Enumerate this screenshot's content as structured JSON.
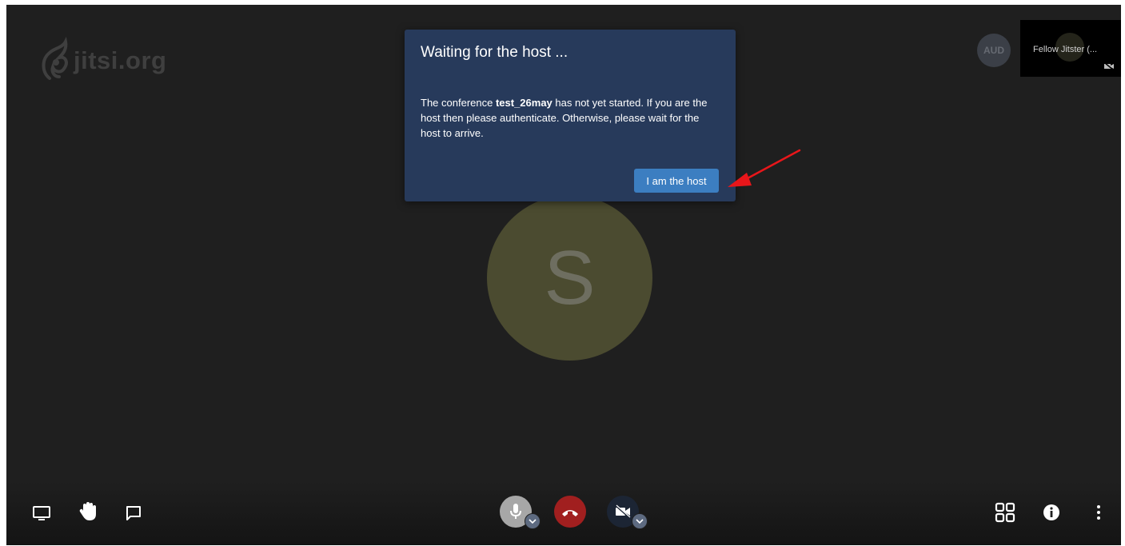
{
  "brand": {
    "name": "jitsi.org"
  },
  "participant": {
    "initial": "S"
  },
  "remote": {
    "badge": "AUD",
    "name": "Fellow Jitster (..."
  },
  "dialog": {
    "title": "Waiting for the host ...",
    "body_before": "The conference ",
    "conference_name": "test_26may",
    "body_after": " has not yet started. If you are the host then please authenticate. Otherwise, please wait for the host to arrive.",
    "button_label": "I am the host"
  },
  "colors": {
    "dialog_bg": "#273a5b",
    "button_bg": "#3c7ec1",
    "hangup": "#a11f1f",
    "annotation_arrow": "#e8161a"
  },
  "icons": {
    "left": [
      "screen-share-icon",
      "raise-hand-icon",
      "chat-icon"
    ],
    "center": [
      "microphone-icon",
      "hangup-icon",
      "camera-off-icon"
    ],
    "right": [
      "tile-view-icon",
      "info-icon",
      "more-options-icon"
    ]
  }
}
